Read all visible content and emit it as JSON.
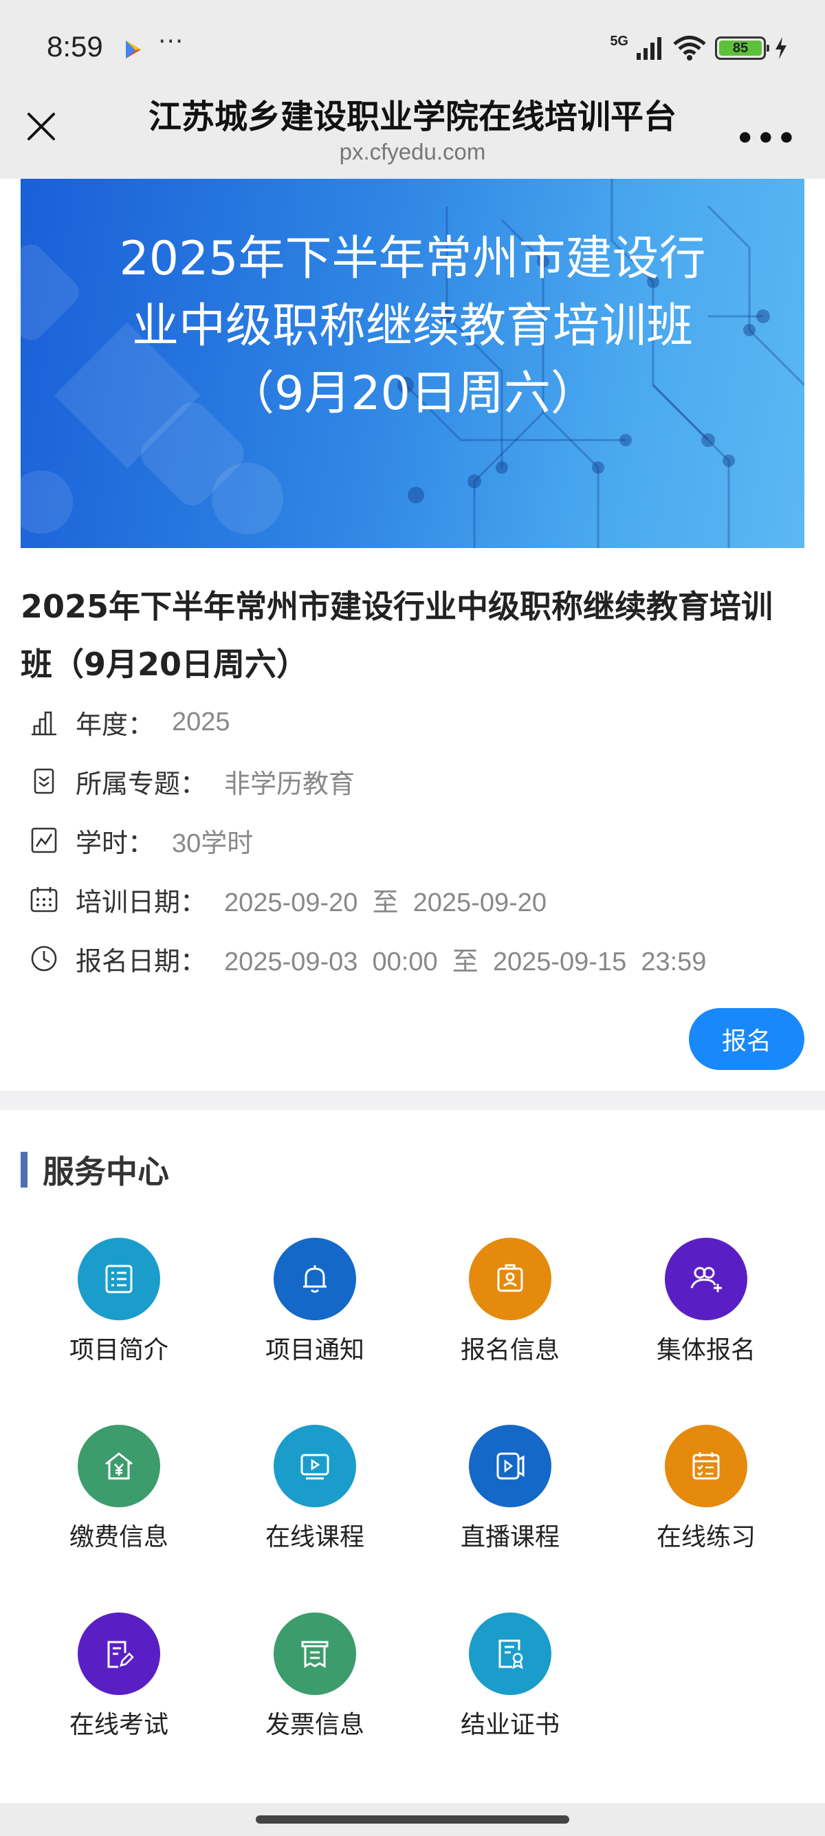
{
  "status_bar": {
    "time": "8:59",
    "network": "5G",
    "battery": "85",
    "more": "···"
  },
  "title_bar": {
    "title": "江苏城乡建设职业学院在线培训平台",
    "url": "px.cfyedu.com",
    "more": "•••"
  },
  "banner": {
    "lines": [
      "2025年下半年常州市建设行",
      "业中级职称继续教育培训班",
      "（9月20日周六）"
    ]
  },
  "project": {
    "title_line1": "2025年下半年常州市建设行业中级职称继续教育培训",
    "title_line2": "班（9月20日周六）",
    "info": [
      {
        "icon": "bar-chart-icon",
        "label": "年度：",
        "value": "2025"
      },
      {
        "icon": "bookmark-icon",
        "label": "所属专题：",
        "value": "非学历教育"
      },
      {
        "icon": "trend-chart-icon",
        "label": "学时：",
        "value": "30学时"
      },
      {
        "icon": "calendar-icon",
        "label": "培训日期：",
        "value": "2025-09-20  至  2025-09-20"
      },
      {
        "icon": "clock-icon",
        "label": "报名日期：",
        "value": "2025-09-03  00:00  至  2025-09-15  23:59"
      }
    ],
    "signup_button": "报名"
  },
  "service_center": {
    "title": "服务中心",
    "tiles": [
      {
        "label": "项目简介",
        "icon": "list-doc-icon",
        "color": "#1a9dcb"
      },
      {
        "label": "项目通知",
        "icon": "bell-icon",
        "color": "#1468c8"
      },
      {
        "label": "报名信息",
        "icon": "id-badge-icon",
        "color": "#e58a0c"
      },
      {
        "label": "集体报名",
        "icon": "group-add-icon",
        "color": "#5a1fc4"
      },
      {
        "label": "缴费信息",
        "icon": "house-yen-icon",
        "color": "#3d9c6c"
      },
      {
        "label": "在线课程",
        "icon": "video-screen-icon",
        "color": "#1a9dcb"
      },
      {
        "label": "直播课程",
        "icon": "live-play-icon",
        "color": "#1468c8"
      },
      {
        "label": "在线练习",
        "icon": "checklist-icon",
        "color": "#e58a0c"
      },
      {
        "label": "在线考试",
        "icon": "exam-edit-icon",
        "color": "#5a1fc4"
      },
      {
        "label": "发票信息",
        "icon": "receipt-icon",
        "color": "#3d9c6c"
      },
      {
        "label": "结业证书",
        "icon": "certificate-icon",
        "color": "#1a9dcb"
      }
    ]
  }
}
